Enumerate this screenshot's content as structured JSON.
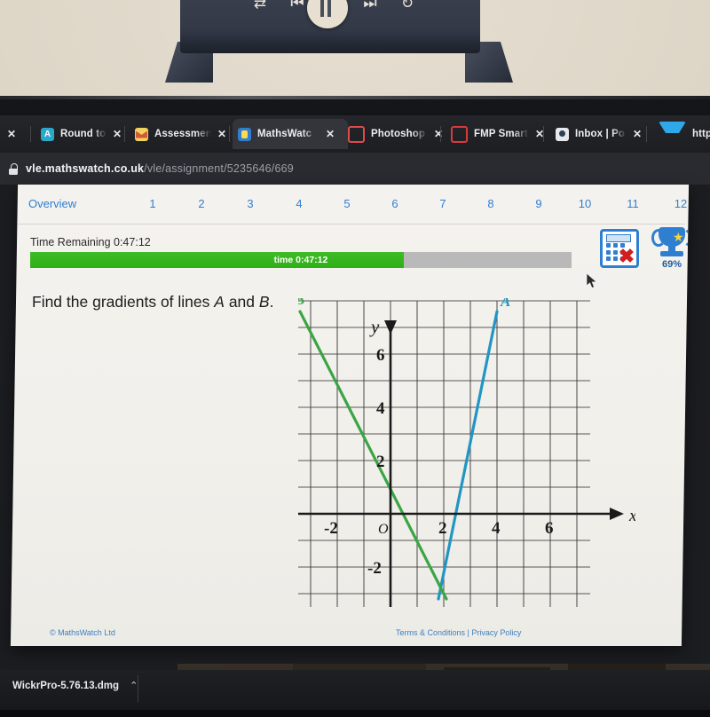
{
  "media_controls": {
    "shuffle": "shuffle-icon",
    "previous": "previous-track-icon",
    "pause": "pause-icon",
    "next": "next-track-icon",
    "repeat": "repeat-icon"
  },
  "browser": {
    "tabs": [
      {
        "label": "Round to s",
        "favicon": "fav-a",
        "close": "✕",
        "active": false
      },
      {
        "label": "Assessmen",
        "favicon": "fav-env",
        "close": "✕",
        "active": false
      },
      {
        "label": "MathsWatc",
        "favicon": "fav-mw",
        "close": "✕",
        "active": true
      },
      {
        "label": "Photoshop",
        "favicon": "fav-ring",
        "close": "✕",
        "active": false
      },
      {
        "label": "FMP Smart",
        "favicon": "fav-ring2",
        "close": "✕",
        "active": false
      },
      {
        "label": "Inbox | Po",
        "favicon": "fav-inbox",
        "close": "✕",
        "active": false
      },
      {
        "label": "https",
        "favicon": "fav-diamond",
        "close": "",
        "active": false
      }
    ],
    "leftmost_close": "✕",
    "url_domain": "vle.mathswatch.co.uk",
    "url_path": "/vle/assignment/5235646/669",
    "lock": "lock-icon"
  },
  "assignment": {
    "overview_label": "Overview",
    "question_numbers": [
      "1",
      "2",
      "3",
      "4",
      "5",
      "6",
      "7",
      "8",
      "9",
      "10",
      "11",
      "12"
    ],
    "time_remaining_label": "Time Remaining 0:47:12",
    "time_bar_text": "time 0:47:12",
    "time_bar_percent": 69,
    "calculator_icon": "calculator-not-allowed-icon",
    "trophy_icon": "trophy-icon",
    "trophy_percent": "69%",
    "question_text_plain": "Find the gradients of lines A and B.",
    "question_prefix": "Find the gradients of lines ",
    "question_var_a": "A",
    "question_mid": " and ",
    "question_var_b": "B",
    "question_suffix": "."
  },
  "footer": {
    "copyright": "© MathsWatch Ltd",
    "terms": "Terms & Conditions | Privacy Policy"
  },
  "downloads": {
    "file_name": "WickrPro-5.76.13.dmg",
    "caret": "⌃"
  },
  "chart_data": {
    "type": "line",
    "title": "Find the gradients of lines A and B.",
    "xlabel": "x",
    "ylabel": "y",
    "xlim": [
      -3.5,
      7.5
    ],
    "ylim": [
      -3.5,
      8
    ],
    "grid": true,
    "grid_step": 1,
    "x_ticks": [
      -2,
      0,
      2,
      4,
      6
    ],
    "x_tick_labels": [
      "-2",
      "O",
      "2",
      "4",
      "6"
    ],
    "y_ticks": [
      -2,
      2,
      4,
      6
    ],
    "y_tick_labels": [
      "-2",
      "2",
      "4",
      "6"
    ],
    "origin_label": "O",
    "series": [
      {
        "name": "A",
        "color": "#2196c4",
        "label": "A",
        "points": [
          [
            1.8,
            -3.2
          ],
          [
            4.0,
            7.6
          ]
        ],
        "gradient": 5
      },
      {
        "name": "B",
        "color": "#3aa545",
        "label": "B",
        "points": [
          [
            -3.4,
            7.6
          ],
          [
            2.1,
            -3.2
          ]
        ],
        "gradient": -2
      }
    ]
  }
}
